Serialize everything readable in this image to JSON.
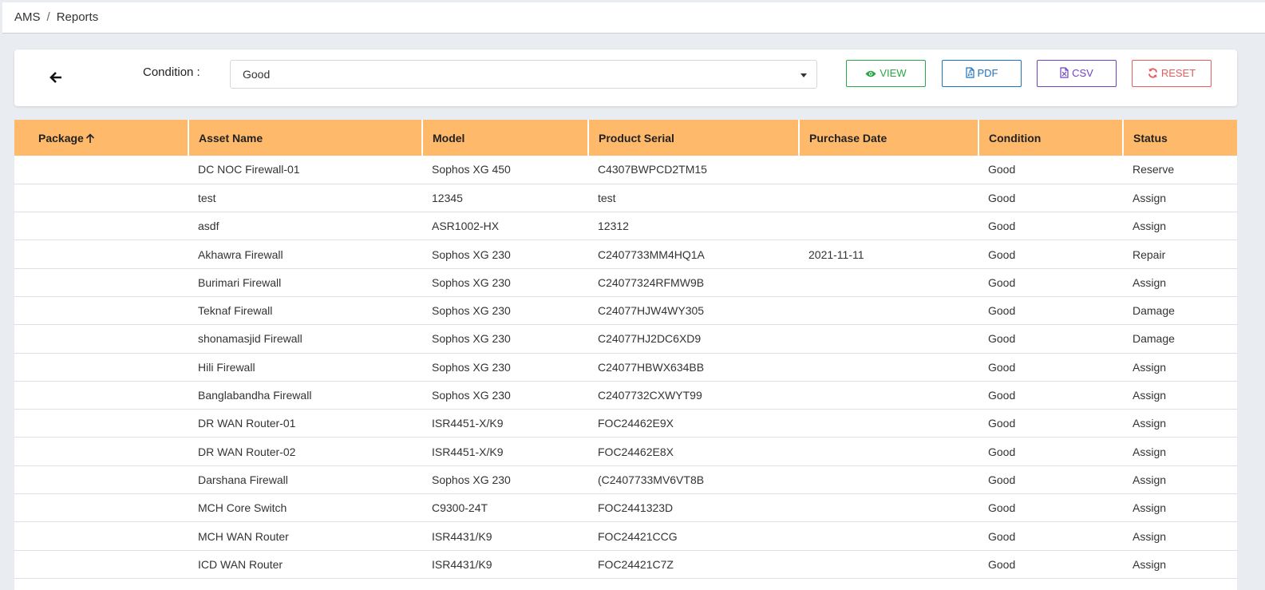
{
  "breadcrumb": {
    "root": "AMS",
    "separator": "/",
    "current": "Reports"
  },
  "filter": {
    "condition_label": "Condition :",
    "condition_value": "Good",
    "buttons": {
      "view": "VIEW",
      "pdf": "PDF",
      "csv": "CSV",
      "reset": "RESET"
    }
  },
  "table": {
    "columns": [
      "Package",
      "Asset Name",
      "Model",
      "Product Serial",
      "Purchase Date",
      "Condition",
      "Status"
    ],
    "rows": [
      [
        "",
        "DC NOC Firewall-01",
        "Sophos XG 450",
        "C4307BWPCD2TM15",
        "",
        "Good",
        "Reserve"
      ],
      [
        "",
        "test",
        "12345",
        "test",
        "",
        "Good",
        "Assign"
      ],
      [
        "",
        "asdf",
        "ASR1002-HX",
        "12312",
        "",
        "Good",
        "Assign"
      ],
      [
        "",
        "Akhawra Firewall",
        "Sophos XG 230",
        "C2407733MM4HQ1A",
        "2021-11-11",
        "Good",
        "Repair"
      ],
      [
        "",
        "Burimari Firewall",
        "Sophos XG 230",
        "C24077324RFMW9B",
        "",
        "Good",
        "Assign"
      ],
      [
        "",
        "Teknaf Firewall",
        "Sophos XG 230",
        "C24077HJW4WY305",
        "",
        "Good",
        "Damage"
      ],
      [
        "",
        "shonamasjid Firewall",
        "Sophos XG 230",
        "C24077HJ2DC6XD9",
        "",
        "Good",
        "Damage"
      ],
      [
        "",
        "Hili Firewall",
        "Sophos XG 230",
        "C24077HBWX634BB",
        "",
        "Good",
        "Assign"
      ],
      [
        "",
        "Banglabandha Firewall",
        "Sophos XG 230",
        "C2407732CXWYT99",
        "",
        "Good",
        "Assign"
      ],
      [
        "",
        "DR WAN Router-01",
        "ISR4451-X/K9",
        "FOC24462E9X",
        "",
        "Good",
        "Assign"
      ],
      [
        "",
        "DR WAN Router-02",
        "ISR4451-X/K9",
        "FOC24462E8X",
        "",
        "Good",
        "Assign"
      ],
      [
        "",
        "Darshana Firewall",
        "Sophos XG 230",
        "(C2407733MV6VT8B",
        "",
        "Good",
        "Assign"
      ],
      [
        "",
        "MCH Core Switch",
        "C9300-24T",
        "FOC2441323D",
        "",
        "Good",
        "Assign"
      ],
      [
        "",
        "MCH WAN Router",
        "ISR4431/K9",
        "FOC24421CCG",
        "",
        "Good",
        "Assign"
      ],
      [
        "",
        "ICD WAN Router",
        "ISR4431/K9",
        "FOC24421C7Z",
        "",
        "Good",
        "Assign"
      ],
      [
        "",
        "",
        "",
        "",
        "",
        "",
        ""
      ]
    ]
  },
  "colors": {
    "header_bg": "#feba6a",
    "view": "#28a745",
    "pdf": "#1e73be",
    "csv": "#6f42c1",
    "reset": "#e35d5d"
  }
}
